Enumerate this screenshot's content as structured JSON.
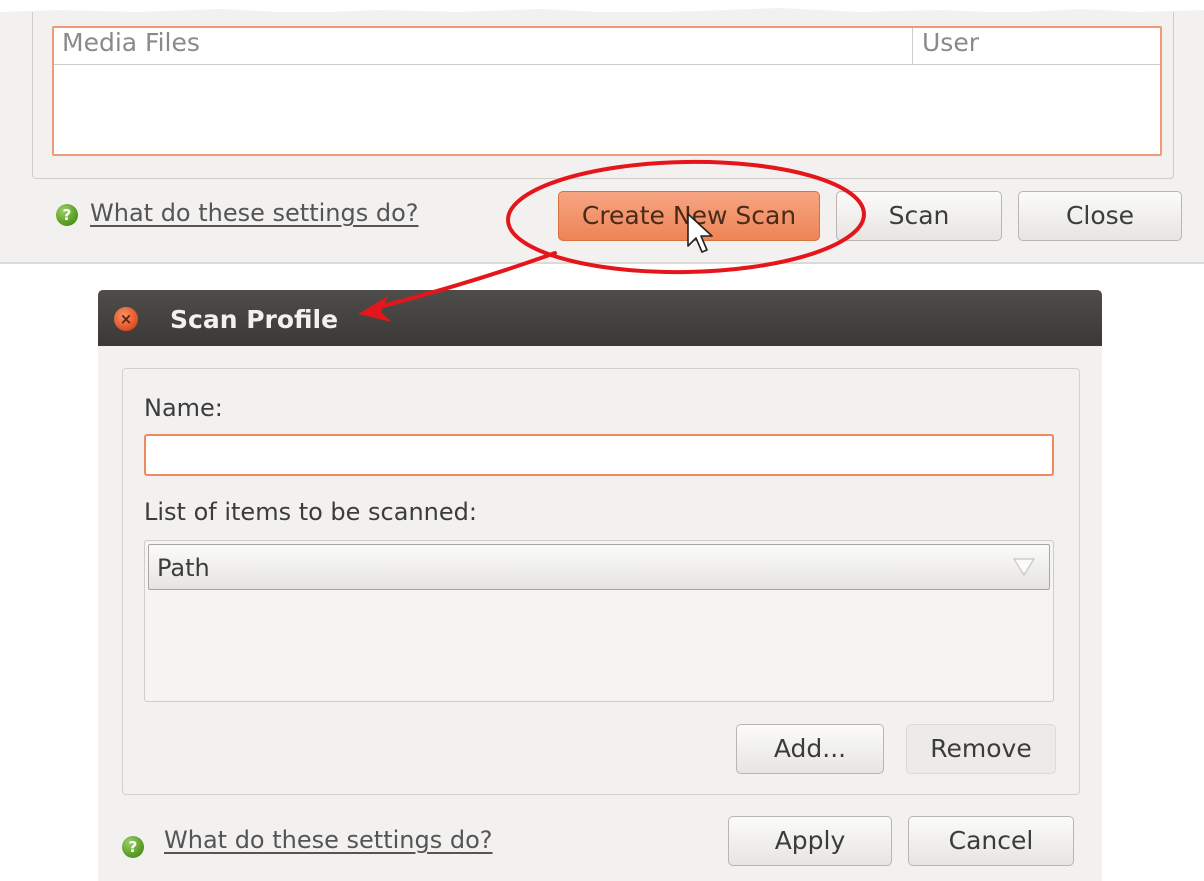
{
  "background_window": {
    "columns": [
      "Media Files",
      "User"
    ],
    "help_link": "What do these settings do?",
    "buttons": {
      "create_new_scan": "Create New Scan",
      "scan": "Scan",
      "close": "Close"
    }
  },
  "dialog": {
    "title": "Scan Profile",
    "name_label": "Name:",
    "name_value": "",
    "items_label": "List of items to be scanned:",
    "items_column": "Path",
    "buttons": {
      "add": "Add...",
      "remove": "Remove",
      "apply": "Apply",
      "cancel": "Cancel"
    },
    "help_link": "What do these settings do?"
  },
  "icons": {
    "help": "help-icon",
    "close": "close-icon",
    "sort": "sort-descending-icon",
    "cursor": "mouse-pointer-icon"
  },
  "colors": {
    "accent": "#ee8455",
    "titlebar": "#3f3e3b",
    "annotation": "#e5161b",
    "help_icon": "#5fa32a"
  }
}
